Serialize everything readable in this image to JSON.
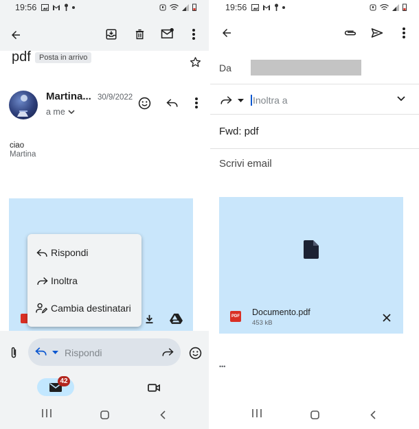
{
  "status": {
    "time_left": "19:56",
    "time_right": "19:56"
  },
  "left": {
    "subject": "pdf",
    "label_chip": "Posta in arrivo",
    "sender_name": "Martina...",
    "date": "30/9/2022",
    "recipient": "a me",
    "body_line1": "ciao",
    "body_line2": "Martina",
    "menu": {
      "reply": "Rispondi",
      "forward": "Inoltra",
      "change_recipients": "Cambia destinatari"
    },
    "reply_bar_label": "Rispondi",
    "mail_badge": "42"
  },
  "right": {
    "from_label": "Da",
    "to_placeholder": "Inoltra a",
    "subject": "Fwd: pdf",
    "compose_placeholder": "Scrivi email",
    "attachment_name": "Documento.pdf",
    "attachment_size": "453 kB",
    "pdf_badge": "PDF",
    "more_dots": "•••"
  },
  "colors": {
    "attachment_bg": "#c9e6fb",
    "accent_blue": "#0b57d0",
    "pdf_red": "#d93025",
    "badge_red": "#b3261e",
    "nav_pill": "#c2e7ff"
  },
  "icons": {
    "back": "arrow-back-icon",
    "archive": "archive-icon",
    "delete": "trash-icon",
    "mark_unread": "mail-unread-icon",
    "more": "more-vert-icon",
    "star": "star-icon",
    "emoji": "emoji-icon",
    "reply": "reply-icon",
    "forward": "forward-icon",
    "attach": "paperclip-icon",
    "send": "send-icon",
    "download": "download-icon",
    "drive": "drive-icon",
    "file": "file-icon",
    "close": "close-icon"
  }
}
